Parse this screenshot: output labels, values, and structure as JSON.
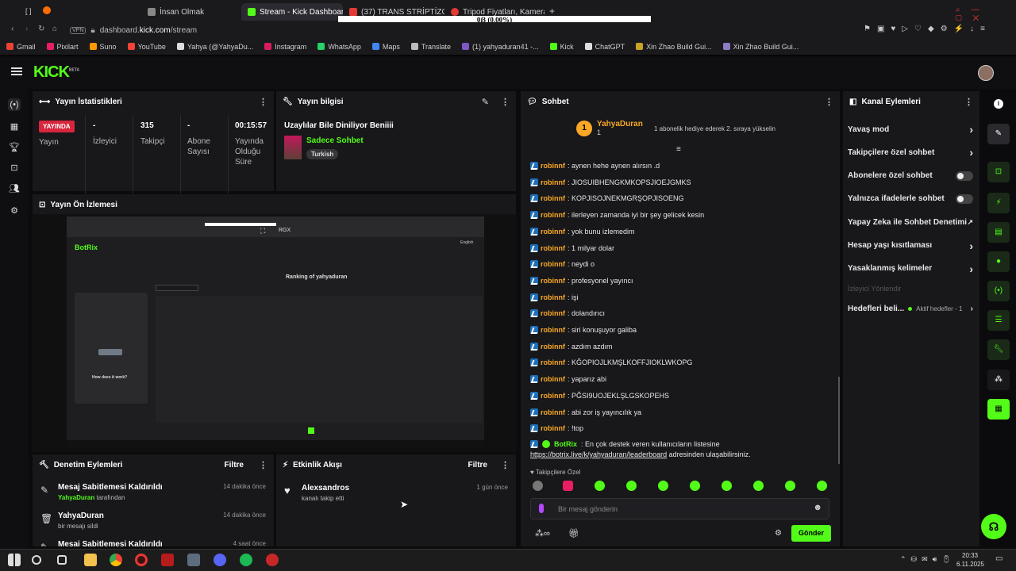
{
  "browser": {
    "tabs": [
      {
        "label": "İnsan Olmak",
        "color": "#888"
      },
      {
        "label": "Stream - Kick Dashboard",
        "color": "#53fc18"
      },
      {
        "label": "(37) TRANS STRİPTİZCİN",
        "color": "#e53935"
      },
      {
        "label": "Tripod Fiyatları, Kamera v",
        "color": "#e53935"
      }
    ],
    "new_tab": "+",
    "vpn": "VPN",
    "url_prefix": "dashboard.",
    "url_domain": "kick.com",
    "url_path": "/stream",
    "overlay_text": "0ẞ (0.00%)",
    "bookmarks": [
      {
        "label": "Gmail",
        "color": "#ea4335"
      },
      {
        "label": "Pixilart",
        "color": "#e91e63"
      },
      {
        "label": "Suno",
        "color": "#ff9800"
      },
      {
        "label": "YouTube",
        "color": "#f44336"
      },
      {
        "label": "Yahya (@YahyaDu...",
        "color": "#dddddd"
      },
      {
        "label": "Instagram",
        "color": "#d81b60"
      },
      {
        "label": "WhatsApp",
        "color": "#25d366"
      },
      {
        "label": "Maps",
        "color": "#4285f4"
      },
      {
        "label": "Translate",
        "color": "#bbbbbb"
      },
      {
        "label": "(1) yahyaduran41 -...",
        "color": "#7e57c2"
      },
      {
        "label": "Kick",
        "color": "#53fc18"
      },
      {
        "label": "ChatGPT",
        "color": "#dddddd"
      },
      {
        "label": "Xin Zhao Build Gui...",
        "color": "#c9a227"
      },
      {
        "label": "Xin Zhao Build Gui...",
        "color": "#8e7cc3"
      }
    ]
  },
  "app": {
    "logo": "KICK",
    "logo_sup": "BETA",
    "accent": "#53fc18"
  },
  "stats": {
    "title": "Yayın İstatistikleri",
    "live_badge": "YAYINDA",
    "live_label": "Yayın",
    "viewers_value": "-",
    "viewers_label": "İzleyici",
    "followers_value": "315",
    "followers_label": "Takipçi",
    "subs_value": "-",
    "subs_label": "Abone Sayısı",
    "uptime_value": "00:15:57",
    "uptime_label": "Yayında Olduğu Süre"
  },
  "stream_info": {
    "title": "Yayın bilgisi",
    "stream_title": "Uzaylılar Bile Diniliyor Beniiii",
    "category": "Sadece Sohbet",
    "language": "Turkish"
  },
  "preview": {
    "title": "Yayın Ön İzlemesi",
    "bot_name": "BotRix",
    "ranking_title": "Ranking of yahyaduran",
    "how_title": "How does it work?",
    "lang": "English"
  },
  "moderation": {
    "title": "Denetim Eylemleri",
    "filter": "Filtre",
    "items": [
      {
        "action": "Mesaj Sabitlemesi Kaldırıldı",
        "by_user": "YahyaDuran",
        "by_suffix": " tarafından",
        "time": "14 dakika önce"
      },
      {
        "action": "YahyaDuran",
        "by_user": "",
        "by_suffix": "bir mesajı sildi",
        "time": "14 dakika önce"
      },
      {
        "action": "Mesaj Sabitlemesi Kaldırıldı",
        "by_user": "",
        "by_suffix": "",
        "time": "4 saat önce"
      }
    ]
  },
  "activity": {
    "title": "Etkinlik Akışı",
    "filter": "Filtre",
    "items": [
      {
        "name": "Alexsandros",
        "desc": "kanalı takip etti",
        "time": "1 gün önce"
      }
    ]
  },
  "chat": {
    "title": "Sohbet",
    "top_user": "YahyaDuran",
    "top_count": "1",
    "top_rank": "1",
    "gift_msg": "1 abonelik hediye ederek 2. sıraya yükselin",
    "messages": [
      {
        "user": "robinnf",
        "text": ": aynen hehe aynen alırsın .d"
      },
      {
        "user": "robinnf",
        "text": ": JIOSUIBHENGKMKOPSJIOEJGMKS"
      },
      {
        "user": "robinnf",
        "text": ": KOPJISOJNEKMGRŞOPJISOENG"
      },
      {
        "user": "robinnf",
        "text": ": ilerleyen zamanda iyi bir şey gelicek kesin"
      },
      {
        "user": "robinnf",
        "text": ": yok bunu izlemedim"
      },
      {
        "user": "robinnf",
        "text": ": 1 milyar dolar"
      },
      {
        "user": "robinnf",
        "text": ": neydi o"
      },
      {
        "user": "robinnf",
        "text": ": profesyonel yayıncı"
      },
      {
        "user": "robinnf",
        "text": ": işi"
      },
      {
        "user": "robinnf",
        "text": ": dolandırıcı"
      },
      {
        "user": "robinnf",
        "text": ": siri konuşuyor galiba"
      },
      {
        "user": "robinnf",
        "text": ": azdım azdım"
      },
      {
        "user": "robinnf",
        "text": ": KĞOPIOJLKMŞLKOFFJIOKLWKOPG"
      },
      {
        "user": "robinnf",
        "text": ": yaparız abi"
      },
      {
        "user": "robinnf",
        "text": ": PĞSI9UOJEKLŞLGSKOPEHS"
      },
      {
        "user": "robinnf",
        "text": ": abi zor iş yayıncılık ya"
      },
      {
        "user": "robinnf",
        "text": ": !top"
      }
    ],
    "botrix_user": "BotRix",
    "botrix_text": ": En çok destek veren kullanıcıların listesine",
    "botrix_link": "https://botrix.live/k/yahyaduran/leaderboard",
    "botrix_tail": " adresinden ulaşabilirsiniz.",
    "followers_only": "Takipçilere Özel",
    "input_placeholder": "Bir mesaj gönderin",
    "send": "Gönder"
  },
  "channel_actions": {
    "title": "Kanal Eylemleri",
    "items": [
      {
        "label": "Yavaş mod",
        "kind": "arrow"
      },
      {
        "label": "Takipçilere özel sohbet",
        "kind": "arrow"
      },
      {
        "label": "Abonelere özel sohbet",
        "kind": "toggle"
      },
      {
        "label": "Yalnızca ifadelerle sohbet",
        "kind": "toggle"
      },
      {
        "label": "Yapay Zeka ile Sohbet Denetimi",
        "kind": "ext"
      },
      {
        "label": "Hesap yaşı kısıtlaması",
        "kind": "arrow"
      },
      {
        "label": "Yasaklanmış kelimeler",
        "kind": "arrow"
      }
    ],
    "viewer_redirect": "İzleyici Yönlendir",
    "goals_label": "Hedefleri beli...",
    "goals_status": "Aktif hedefler - 1"
  },
  "taskbar": {
    "time": "20:33",
    "date": "6.11.2025"
  }
}
